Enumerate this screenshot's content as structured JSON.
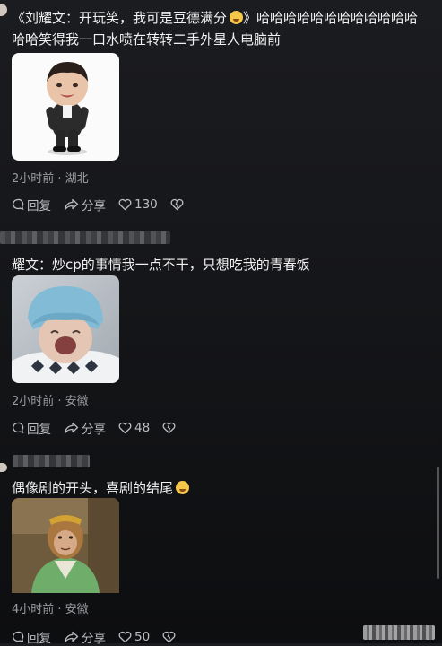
{
  "comments": [
    {
      "text": "《刘耀文：开玩笑，我可是豆德满分",
      "text_tail": "》哈哈哈哈哈哈哈哈哈哈哈哈哈哈笑得我一口水喷在转转二手外星人电脑前",
      "emoji": "smiling-thinking-emoji",
      "time_location": "2小时前 · 湖北",
      "reply_label": "回复",
      "share_label": "分享",
      "likes": "130"
    },
    {
      "text": "耀文：炒cp的事情我一点不干，只想吃我的青春饭",
      "time_location": "2小时前 · 安徽",
      "reply_label": "回复",
      "share_label": "分享",
      "likes": "48"
    },
    {
      "text": "偶像剧的开头，喜剧的结尾",
      "emoji": "smiling-emoji",
      "time_location": "4小时前 · 安徽",
      "reply_label": "回复",
      "share_label": "分享",
      "likes": "50"
    }
  ],
  "colors": {
    "background": "#16171a",
    "meta_text": "#9a9ba0",
    "action_text": "#bcbdc2"
  }
}
